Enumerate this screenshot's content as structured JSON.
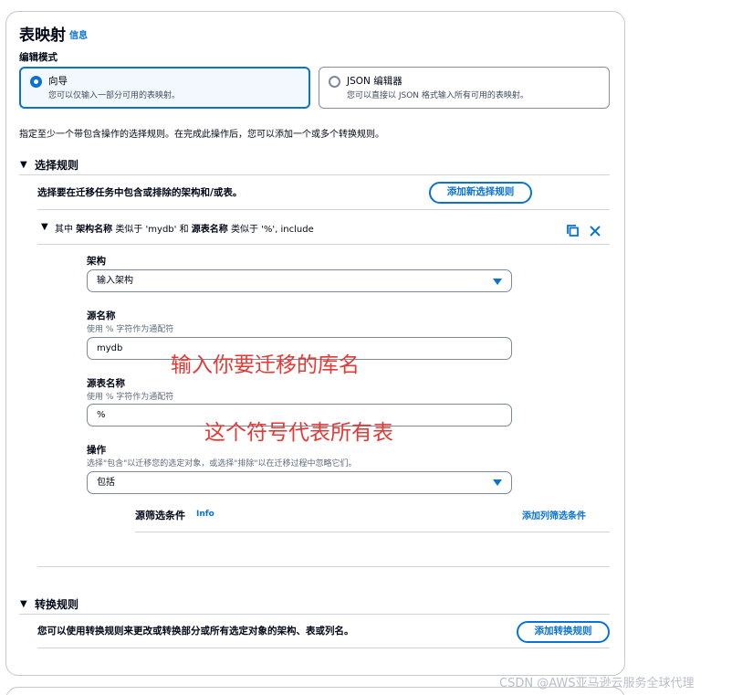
{
  "header": {
    "title": "表映射",
    "info_link": "信息"
  },
  "edit_mode": {
    "label": "编辑模式",
    "options": [
      {
        "title": "向导",
        "desc": "您可以仅输入一部分可用的表映射。",
        "selected": true
      },
      {
        "title": "JSON 编辑器",
        "desc": "您可以直接以 JSON 格式输入所有可用的表映射。",
        "selected": false
      }
    ]
  },
  "intro_text": "指定至少一个带包含操作的选择规则。在完成此操作后，您可以添加一个或多个转换规则。",
  "selection_rules": {
    "title": "选择规则",
    "desc": "选择要在迁移任务中包含或排除的架构和/或表。",
    "add_button": "添加新选择规则",
    "rule": {
      "summary_prefix": "其中",
      "schema_label": "架构名称",
      "like1": "类似于 'mydb' 和",
      "table_label": "源表名称",
      "like2": "类似于 '%', include"
    },
    "form": {
      "schema": {
        "label": "架构",
        "value": "输入架构"
      },
      "source_name": {
        "label": "源名称",
        "desc": "使用 % 字符作为通配符",
        "value": "mydb"
      },
      "source_table": {
        "label": "源表名称",
        "desc": "使用 % 字符作为通配符",
        "value": "%"
      },
      "action": {
        "label": "操作",
        "desc": "选择\"包含\"以迁移您的选定对象，或选择\"排除\"以在迁移过程中忽略它们。",
        "value": "包括"
      }
    },
    "filter": {
      "title": "源筛选条件",
      "info": "Info",
      "add_link": "添加列筛选条件"
    }
  },
  "transform_rules": {
    "title": "转换规则",
    "desc": "您可以使用转换规则来更改或转换部分或所有选定对象的架构、表或列名。",
    "add_button": "添加转换规则"
  },
  "annotations": {
    "db_note": "输入你要迁移的库名",
    "table_note": "这个符号代表所有表"
  },
  "watermark": "CSDN @AWS亚马逊云服务全球代理",
  "colors": {
    "accent": "#0972d3",
    "annotation": "#e53935"
  }
}
